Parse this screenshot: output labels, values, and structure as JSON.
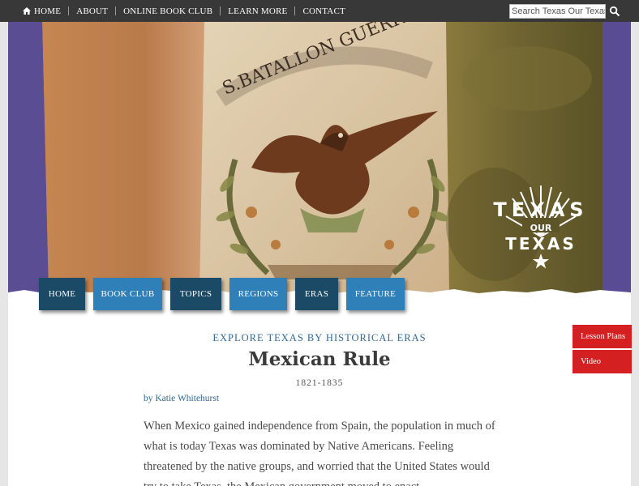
{
  "topnav": {
    "items": [
      "HOME",
      "ABOUT",
      "ONLINE BOOK CLUB",
      "LEARN MORE",
      "CONTACT"
    ]
  },
  "search": {
    "placeholder": "Search Texas Our Texas"
  },
  "logo": {
    "word1": "TEXAS",
    "word2": "OUR",
    "word3": "TEXAS"
  },
  "flag": {
    "inscription": "S.BATALLON GUERR"
  },
  "mainnav": {
    "items": [
      {
        "label": "HOME",
        "style": "dark"
      },
      {
        "label": "BOOK CLUB",
        "style": "light"
      },
      {
        "label": "TOPICS",
        "style": "dark"
      },
      {
        "label": "REGIONS",
        "style": "light"
      },
      {
        "label": "ERAS",
        "style": "dark"
      },
      {
        "label": "FEATURE",
        "style": "light"
      }
    ]
  },
  "sidetabs": {
    "lesson_plans": "Lesson Plans",
    "video": "Video"
  },
  "article": {
    "kicker": "EXPLORE TEXAS BY HISTORICAL ERAS",
    "title": "Mexican Rule",
    "dates": "1821-1835",
    "byline": "by Katie Whitehurst",
    "body": "When Mexico gained independence from Spain, the population in much of what is today Texas was dominated by Native Americans. Feeling threatened by the native groups, and worried that the United States would try to take Texas, the Mexican government moved to enact"
  },
  "colors": {
    "topbar": "#383838",
    "nav_dark": "#1b4a66",
    "nav_light": "#2f7fb8",
    "side_tab": "#d42020",
    "link": "#2e6a98"
  }
}
